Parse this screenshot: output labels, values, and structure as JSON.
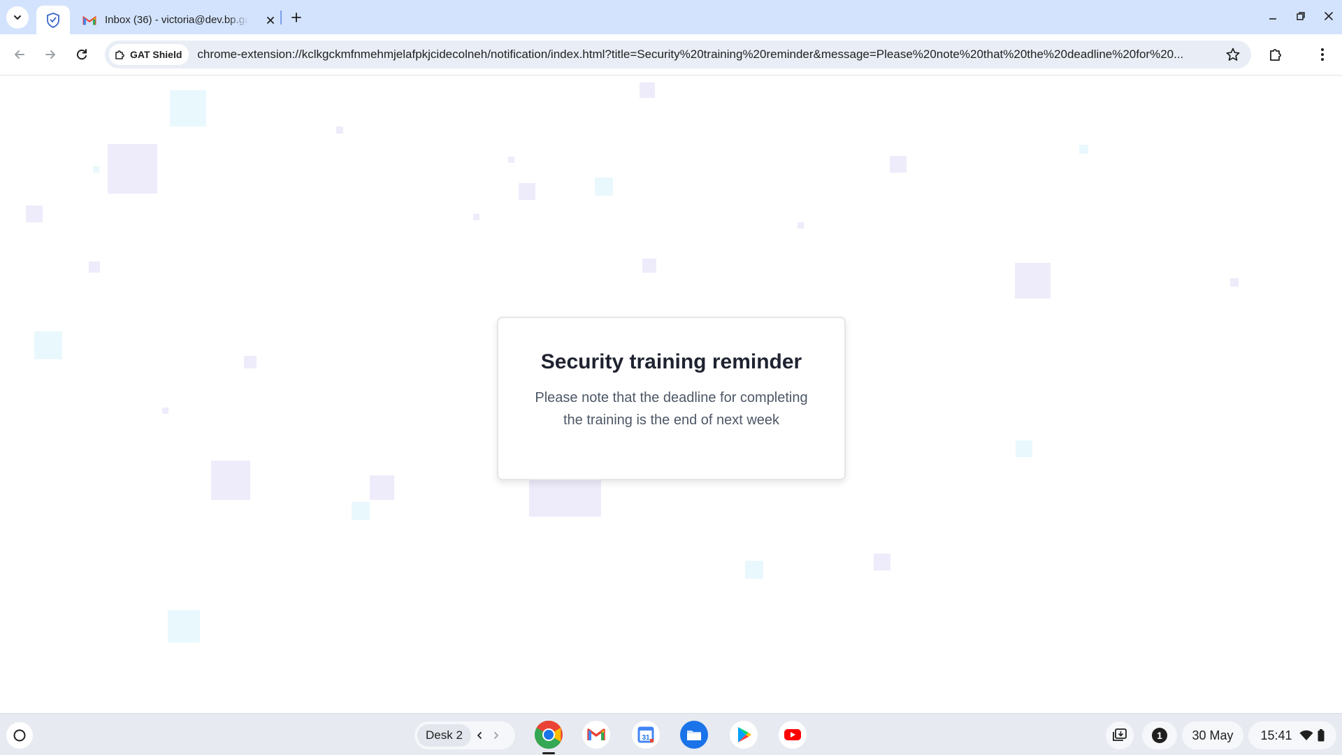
{
  "browser": {
    "tabs": [
      {
        "label": "Inbox (36) - victoria@dev.bp.gat"
      }
    ],
    "site_chip": "GAT Shield",
    "url": "chrome-extension://kclkgckmfnmehmjelafpkjcidecolneh/notification/index.html?title=Security%20training%20reminder&message=Please%20note%20that%20the%20deadline%20for%20..."
  },
  "notification": {
    "title": "Security training reminder",
    "message": "Please note that the deadline for completing the training is the end of next week"
  },
  "shelf": {
    "desk_name": "Desk 2",
    "notification_count": "1",
    "date": "30 May",
    "time": "15:41",
    "apps": [
      "chrome-icon",
      "gmail-icon",
      "calendar-icon",
      "files-icon",
      "play-store-icon",
      "youtube-icon"
    ],
    "calendar_day": "31"
  },
  "colors": {
    "tabstrip": "#d3e3fd",
    "omnibox": "#e9eef6",
    "title_text": "#1f2330",
    "message_text": "#4d5766"
  }
}
